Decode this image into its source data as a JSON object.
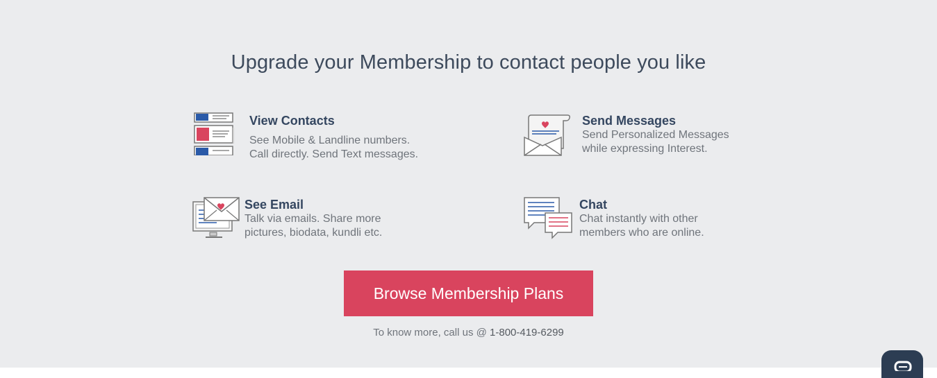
{
  "headline": "Upgrade your Membership to contact people you like",
  "features": [
    {
      "title": "View Contacts",
      "line1": "See Mobile & Landline numbers.",
      "line2": "Call directly. Send Text messages.",
      "icon": "contact-cards-icon"
    },
    {
      "title": "Send Messages",
      "line1": "Send Personalized Messages",
      "line2": "while expressing Interest.",
      "icon": "love-letter-icon"
    },
    {
      "title": "See Email",
      "line1": "Talk via emails. Share more",
      "line2": "pictures, biodata, kundli etc.",
      "icon": "email-monitor-icon"
    },
    {
      "title": "Chat",
      "line1": "Chat instantly with other",
      "line2": "members who are online.",
      "icon": "chat-bubbles-icon"
    }
  ],
  "cta": {
    "label": "Browse Membership Plans"
  },
  "contact": {
    "prefix": "To know more, call us @ ",
    "phone": "1-800-419-6299"
  },
  "colors": {
    "background": "#ebecee",
    "accent": "#d9445e",
    "heading": "#344660",
    "icon_blue": "#2a5aa8",
    "icon_red": "#d9445e"
  }
}
